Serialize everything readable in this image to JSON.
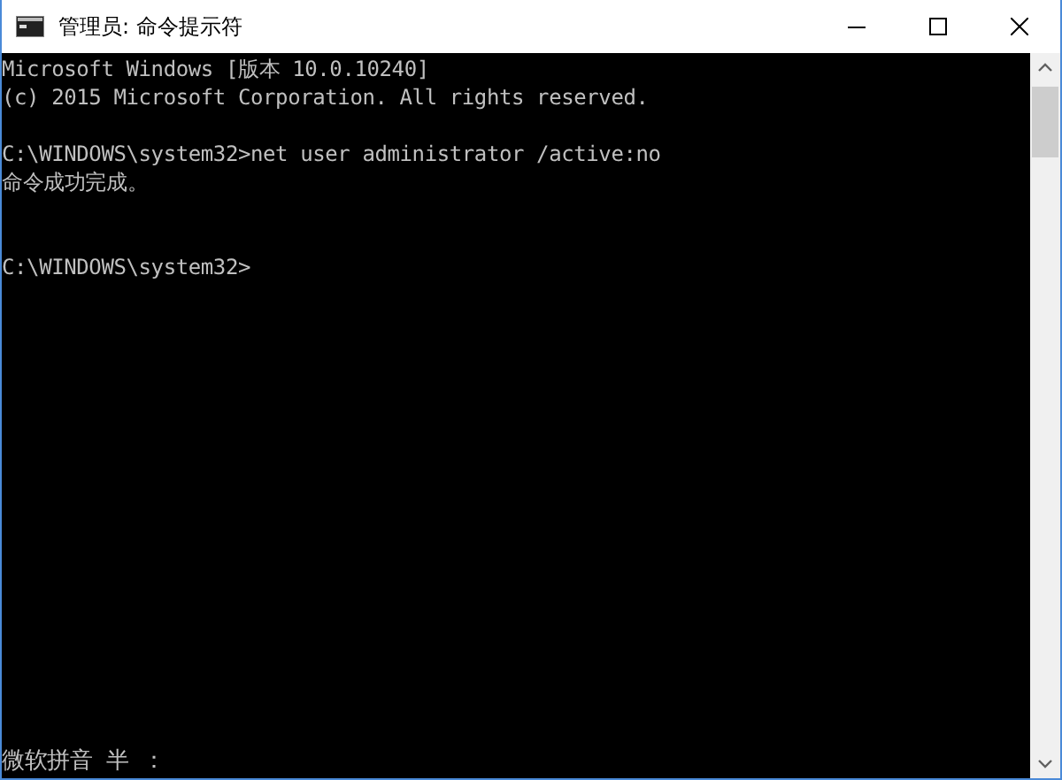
{
  "window": {
    "title": "管理员: 命令提示符"
  },
  "console": {
    "lines": [
      {
        "kind": "text",
        "text": "Microsoft Windows [版本 10.0.10240]"
      },
      {
        "kind": "text",
        "text": "(c) 2015 Microsoft Corporation. All rights reserved."
      },
      {
        "kind": "blank"
      },
      {
        "kind": "text",
        "text": "C:\\WINDOWS\\system32>net user administrator /active:no"
      },
      {
        "kind": "text",
        "text": "命令成功完成。"
      },
      {
        "kind": "blank"
      },
      {
        "kind": "blank"
      },
      {
        "kind": "text",
        "text": "C:\\WINDOWS\\system32>"
      }
    ]
  },
  "ime_status": "微软拼音 半 ："
}
